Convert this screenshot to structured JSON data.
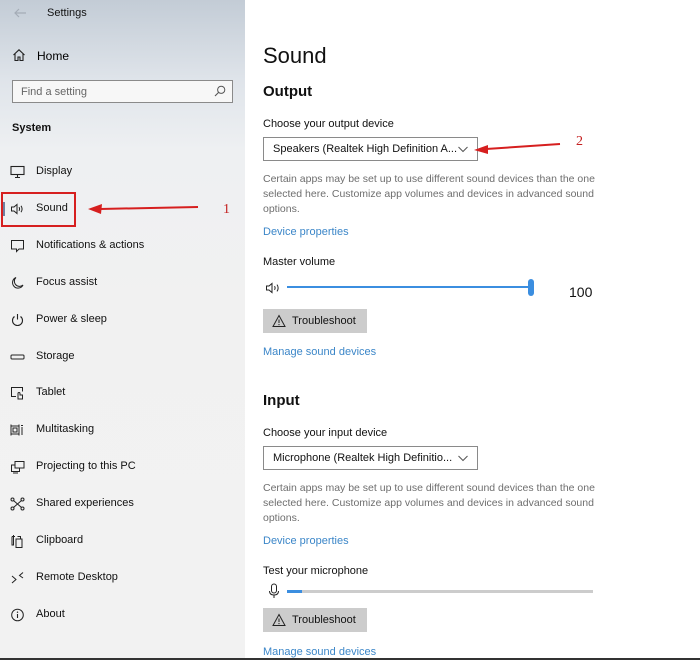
{
  "window": {
    "title": "Settings",
    "back_icon": "arrow-left-icon"
  },
  "sidebar": {
    "home_label": "Home",
    "search_placeholder": "Find a setting",
    "section_label": "System",
    "items": [
      {
        "label": "Display",
        "icon": "monitor-icon",
        "active": false
      },
      {
        "label": "Sound",
        "icon": "speaker-icon",
        "active": true
      },
      {
        "label": "Notifications & actions",
        "icon": "notification-icon",
        "active": false
      },
      {
        "label": "Focus assist",
        "icon": "moon-icon",
        "active": false
      },
      {
        "label": "Power & sleep",
        "icon": "power-icon",
        "active": false
      },
      {
        "label": "Storage",
        "icon": "storage-icon",
        "active": false
      },
      {
        "label": "Tablet",
        "icon": "tablet-icon",
        "active": false
      },
      {
        "label": "Multitasking",
        "icon": "multitasking-icon",
        "active": false
      },
      {
        "label": "Projecting to this PC",
        "icon": "projecting-icon",
        "active": false
      },
      {
        "label": "Shared experiences",
        "icon": "shared-experiences-icon",
        "active": false
      },
      {
        "label": "Clipboard",
        "icon": "clipboard-icon",
        "active": false
      },
      {
        "label": "Remote Desktop",
        "icon": "remote-desktop-icon",
        "active": false
      },
      {
        "label": "About",
        "icon": "info-icon",
        "active": false
      }
    ]
  },
  "main": {
    "title": "Sound",
    "output": {
      "heading": "Output",
      "device_label": "Choose your output device",
      "device_value": "Speakers (Realtek High Definition A...",
      "description": "Certain apps may be set up to use different sound devices than the one selected here. Customize app volumes and devices in advanced sound options.",
      "device_properties_link": "Device properties",
      "master_volume_label": "Master volume",
      "master_volume_value": "100",
      "master_volume_percent": 100,
      "troubleshoot_label": "Troubleshoot",
      "manage_link": "Manage sound devices"
    },
    "input": {
      "heading": "Input",
      "device_label": "Choose your input device",
      "device_value": "Microphone (Realtek High Definitio...",
      "description": "Certain apps may be set up to use different sound devices than the one selected here. Customize app volumes and devices in advanced sound options.",
      "device_properties_link": "Device properties",
      "test_label": "Test your microphone",
      "mic_level_percent": 5,
      "troubleshoot_label": "Troubleshoot",
      "manage_link": "Manage sound devices"
    }
  },
  "annotations": {
    "marker_1": "1",
    "marker_2": "2",
    "color": "#d61f1f"
  },
  "colors": {
    "accent": "#3b8ee0",
    "link": "#3b86c8",
    "button_bg": "#cccccc",
    "annotation": "#d61f1f"
  }
}
